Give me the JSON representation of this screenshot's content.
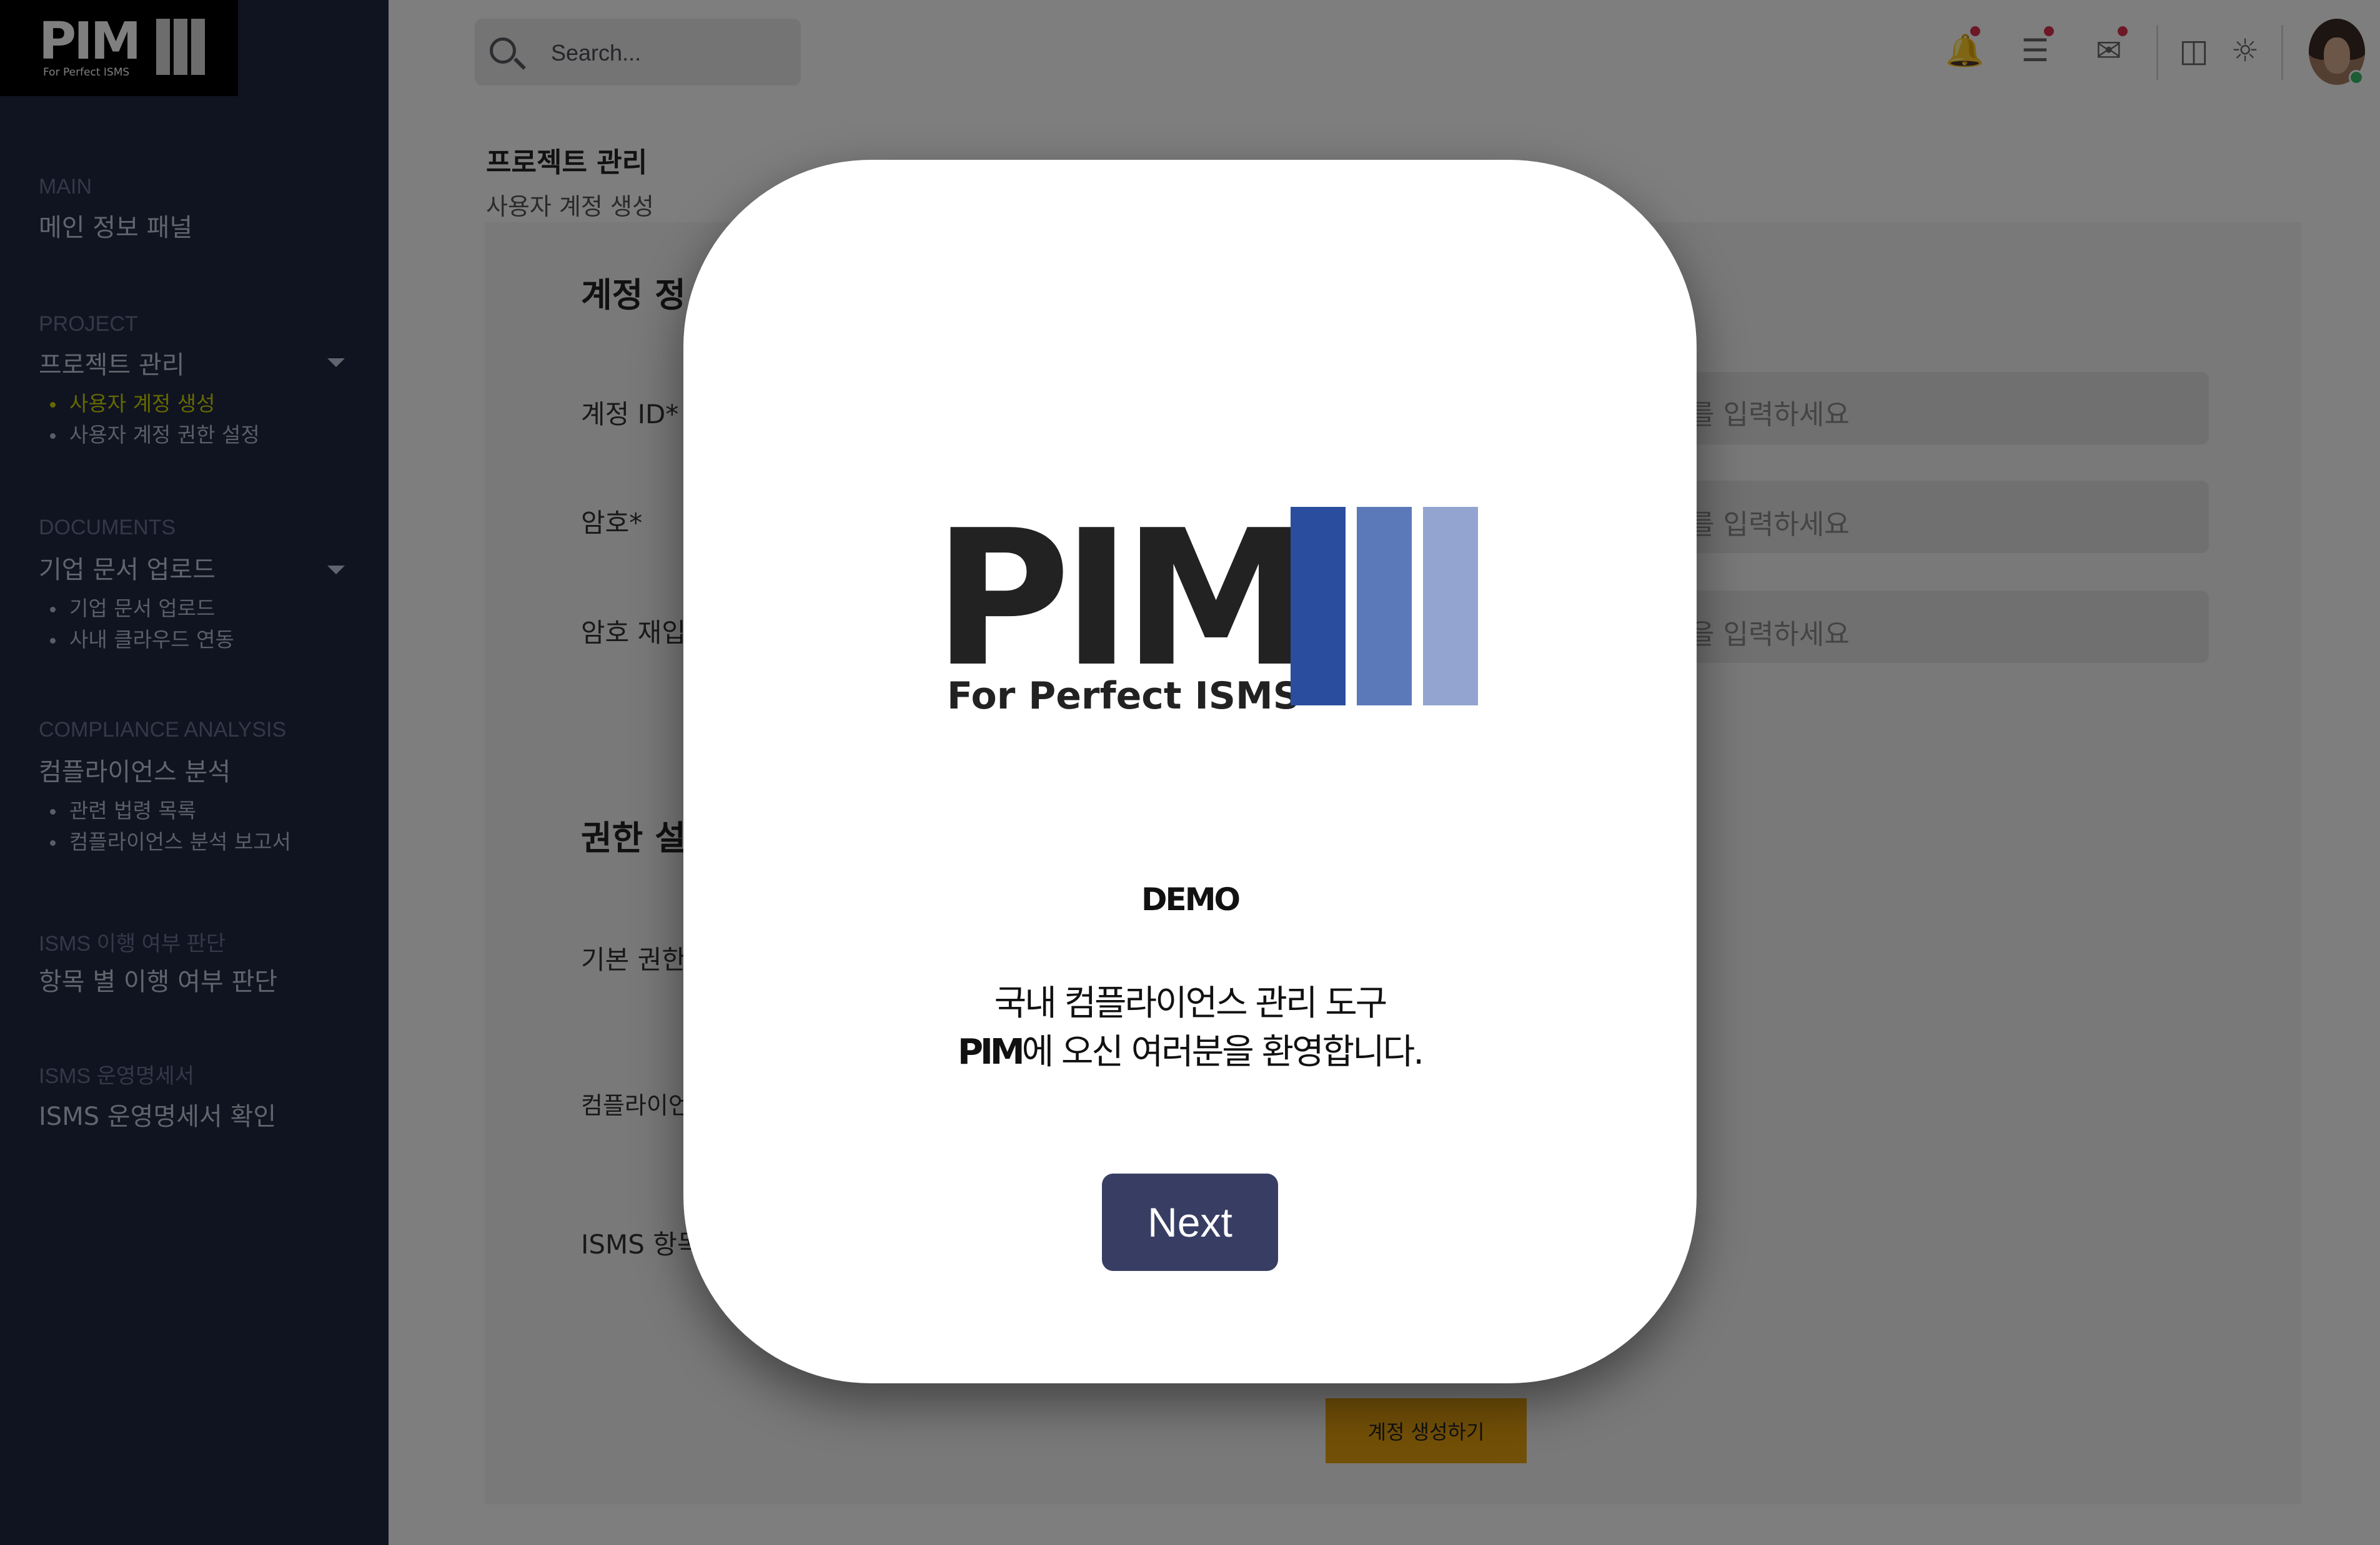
{
  "app": {
    "logo_text": "PIM",
    "logo_tagline": "For Perfect ISMS"
  },
  "sidebar": {
    "sections": [
      {
        "category": "MAIN",
        "head": "메인 정보 패널"
      },
      {
        "category": "PROJECT",
        "head": "프로젝트 관리",
        "items": [
          "사용자 계정 생성",
          "사용자 계정 권한 설정"
        ]
      },
      {
        "category": "DOCUMENTS",
        "head": "기업 문서 업로드",
        "items": [
          "기업 문서 업로드",
          "사내 클라우드 연동"
        ]
      },
      {
        "category": "COMPLIANCE ANALYSIS",
        "head": "컴플라이언스 분석",
        "items": [
          "관련 법령 목록",
          "컴플라이언스 분석 보고서"
        ]
      },
      {
        "category": "ISMS 이행 여부 판단",
        "head": "항목 별 이행 여부 판단"
      },
      {
        "category": "ISMS 운영명세서",
        "head": "ISMS 운영명세서 확인"
      }
    ],
    "active_color": "#c9d200"
  },
  "topbar": {
    "search_placeholder": "Search...",
    "icons": [
      "bell-icon",
      "list-icon",
      "mail-icon",
      "translate-icon",
      "sun-icon"
    ],
    "notification_color": "#d8304e"
  },
  "page": {
    "title": "프로젝트 관리",
    "subtitle": "사용자 계정 생성",
    "section1": "계정 정",
    "fields": [
      {
        "label": "계정 ID*",
        "placeholder": "를 입력하세요"
      },
      {
        "label": "암호*",
        "placeholder": "를 입력하세요"
      },
      {
        "label": "암호 재입",
        "placeholder": "을 입력하세요"
      }
    ],
    "section2": "권한 설",
    "labels": [
      "기본 권한",
      "컴플라이언",
      "ISMS 항목"
    ],
    "submit_label": "계정 생성하기"
  },
  "modal": {
    "logo_text": "PIM",
    "logo_tagline": "For Perfect ISMS",
    "logo_colors": [
      "#2b4d9e",
      "#5b79b8",
      "#93a4d0"
    ],
    "demo_label": "DEMO",
    "welcome_line1": "국내 컴플라이언스 관리 도구",
    "welcome_brand": "PIM",
    "welcome_line2": "에 오신 여러분을 환영합니다.",
    "next_label": "Next",
    "next_color": "#383e63"
  }
}
